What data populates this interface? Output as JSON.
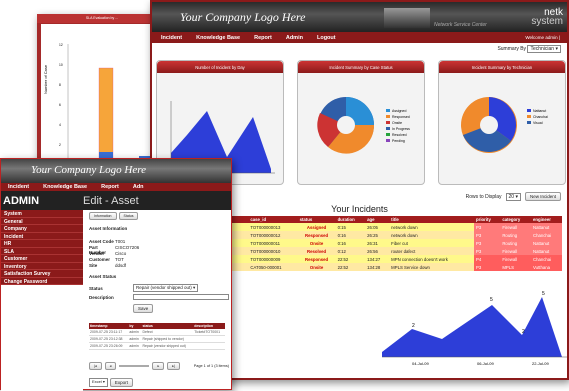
{
  "w1": {
    "title": "SLA Evaluation by ...",
    "ylabel": "Number of Case",
    "yticks": [
      "12",
      "10",
      "8",
      "6",
      "4",
      "2",
      "0"
    ],
    "xticks": [
      "13-Jun-09",
      "16-Jun-09"
    ],
    "legend": [
      "Overdue : 30 Case (83.33%)",
      "On time : 6 Ca"
    ]
  },
  "w2": {
    "logo": "Your Company Logo Here",
    "service": "Network Service Center",
    "brand1": "netk",
    "brand2": "system",
    "nav": [
      "Incident",
      "Knowledge Base",
      "Report",
      "Admin",
      "Logout"
    ],
    "welcome": "Welcome admin |",
    "summary_label": "Summary By",
    "summary_value": "Technician",
    "panels": [
      "Number of Incident by Day",
      "Incident Summary by Case Status",
      "Incident Summary by Technician"
    ],
    "status_legend": [
      "Assigned",
      "Responsed",
      "Onsite",
      "In Progress",
      "Resolved",
      "Pending"
    ],
    "tech_legend": [
      "Nattanut",
      "Chanchai",
      "Visual"
    ],
    "rows_label": "Rows to Display",
    "rows_value": "20",
    "new_btn": "New Incident",
    "heading": "Your Incidents",
    "cols": [
      "Update",
      "created date",
      "case_id",
      "status",
      "duration",
      "age",
      "title",
      "priority",
      "category",
      "engineer"
    ],
    "rows": [
      [
        "2009-07-22 11:58:01",
        "TOT000000013",
        "Assigned",
        "0:15",
        "26:05",
        "network down",
        "P3",
        "Firewall",
        "Nattanut"
      ],
      [
        "2009-07-22 11:37:11",
        "TOT000000012",
        "Responsed",
        "0:16",
        "26:25",
        "network down",
        "P3",
        "Routing",
        "Chanchai"
      ],
      [
        "2009-07-22 11:34:17",
        "TOT000000011",
        "Onsite",
        "0:16",
        "26:31",
        "Fiber cut",
        "P3",
        "Routing",
        "Nattanut"
      ],
      [
        "2009-07-22 11:49:54",
        "TOT000000010",
        "Resolved",
        "0:12",
        "26:56",
        "router dafect",
        "P3",
        "Firewall",
        "Nattanut"
      ],
      [
        "2009-07-19 22:23:17",
        "TOT000000009",
        "Responsed",
        "22:52",
        "134:27",
        "MPN connection doesn't work",
        "P4",
        "Firewall",
        "Chanchai"
      ],
      [
        "2009-07-19 06:28:34",
        "CAT050-000001",
        "Onsite",
        "22:52",
        "134:28",
        "MPLS Service down",
        "P3",
        "MPLS",
        "Vutthana"
      ]
    ],
    "chart_data": {
      "type": "line",
      "title": "Number of Incident by Day",
      "x": [
        "04-Jul-09",
        "06-Jul-09",
        "22-Jul-09"
      ],
      "values": [
        1,
        2,
        5,
        2,
        5,
        1
      ],
      "labels": [
        "2",
        "5",
        "2",
        "5"
      ]
    }
  },
  "w3": {
    "logo": "Your Company Logo Here",
    "nav": [
      "Incident",
      "Knowledge Base",
      "Report",
      "Adn"
    ],
    "admin": "ADMIN",
    "title": "Edit - Asset",
    "menu": [
      "System",
      "General",
      "Company",
      "Incident",
      "HR",
      "SLA",
      "Customer",
      "Inventory",
      "Satisfaction Survey",
      "Change Password"
    ],
    "tabs": [
      "Information",
      "Status"
    ],
    "asset_info": "Asset Information",
    "fields": [
      [
        "Asset Code",
        "T001"
      ],
      [
        "Part Number",
        "CISCO7206"
      ],
      [
        "Vendor",
        "Cisco"
      ],
      [
        "Customer",
        "TOT"
      ],
      [
        "Site",
        "ddsdf"
      ]
    ],
    "asset_status": "Asset Status",
    "status_label": "Status",
    "status_value": "Repair (vendor shipped out)",
    "desc_label": "Description",
    "save": "Save",
    "hist_cols": [
      "timestamp",
      "by",
      "status",
      "description"
    ],
    "hist": [
      [
        "2009-07-25 23:11:17",
        "admin",
        "Defect",
        "Ticket#TOT0001"
      ],
      [
        "2009-07-25 23:12:38",
        "admin",
        "Repair (shipped to vendor)",
        ""
      ],
      [
        "2009-07-25 23:26:09",
        "admin",
        "Repair (vendor shipped out)",
        ""
      ]
    ],
    "page": "Page 1 of 1 (3 items)",
    "export_value": "Excel",
    "export": "Export"
  }
}
